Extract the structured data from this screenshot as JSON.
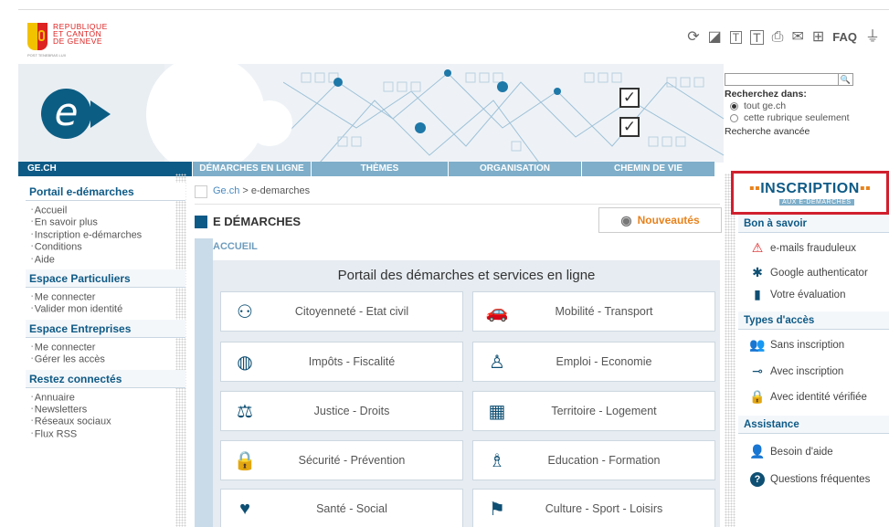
{
  "header": {
    "logo_lines": [
      "REPUBLIQUE",
      "ET CANTON",
      "DE GENEVE"
    ],
    "logo_sub": "POST TENEBRAS LUX",
    "toolbar": [
      {
        "name": "share-icon",
        "glyph": "⟳"
      },
      {
        "name": "edit-icon",
        "glyph": "◪"
      },
      {
        "name": "text-small-icon",
        "glyph": "T"
      },
      {
        "name": "text-large-icon",
        "glyph": "T"
      },
      {
        "name": "print-icon",
        "glyph": "⎙"
      },
      {
        "name": "mail-icon",
        "glyph": "✉"
      },
      {
        "name": "sitemap-icon",
        "glyph": "⊞"
      },
      {
        "name": "faq-link",
        "glyph": "FAQ"
      },
      {
        "name": "accessibility-icon",
        "glyph": "⏚"
      }
    ]
  },
  "banner": {
    "e_letter": "e"
  },
  "search": {
    "button": "🔍",
    "label": "Recherchez dans:",
    "options": [
      "tout ge.ch",
      "cette rubrique seulement"
    ],
    "advanced": "Recherche avancée"
  },
  "nav": {
    "home": "GE.CH",
    "tabs": [
      "DÉMARCHES EN LIGNE",
      "THÈMES",
      "ORGANISATION",
      "CHEMIN DE VIE"
    ]
  },
  "sidebar": {
    "sections": [
      {
        "title": "Portail e-démarches",
        "items": [
          "Accueil",
          "En savoir plus",
          "Inscription e-démarches",
          "Conditions",
          "Aide"
        ]
      },
      {
        "title": "Espace Particuliers",
        "items": [
          "Me connecter",
          "Valider mon identité"
        ]
      },
      {
        "title": "Espace Entreprises",
        "items": [
          "Me connecter",
          "Gérer les accès"
        ]
      },
      {
        "title": "Restez connectés",
        "items": [
          "Annuaire",
          "Newsletters",
          "Réseaux sociaux",
          "Flux RSS"
        ]
      }
    ]
  },
  "main": {
    "breadcrumb_home": "Ge.ch",
    "breadcrumb_sep": " > ",
    "breadcrumb_current": "e-demarches",
    "heading": "E DÉMARCHES",
    "news_button": "Nouveautés",
    "section_label": "ACCUEIL",
    "panel_title": "Portail des démarches et services en ligne",
    "cards": [
      {
        "label": "Citoyenneté - Etat civil",
        "icon": "citizenship-icon",
        "glyph": "⚇"
      },
      {
        "label": "Mobilité - Transport",
        "icon": "car-icon",
        "glyph": "🚗"
      },
      {
        "label": "Impôts - Fiscalité",
        "icon": "coins-icon",
        "glyph": "◍"
      },
      {
        "label": "Emploi - Economie",
        "icon": "worker-icon",
        "glyph": "♙"
      },
      {
        "label": "Justice - Droits",
        "icon": "scales-icon",
        "glyph": "⚖"
      },
      {
        "label": "Territoire - Logement",
        "icon": "building-icon",
        "glyph": "▦"
      },
      {
        "label": "Sécurité - Prévention",
        "icon": "lock-icon",
        "glyph": "🔒"
      },
      {
        "label": "Education - Formation",
        "icon": "teacher-icon",
        "glyph": "♗"
      },
      {
        "label": "Santé - Social",
        "icon": "heart-hands-icon",
        "glyph": "♥"
      },
      {
        "label": "Culture - Sport - Loisirs",
        "icon": "runner-icon",
        "glyph": "⚑"
      }
    ]
  },
  "right": {
    "inscription_main": "INSCRIPTION",
    "inscription_sub": "AUX E-DÉMARCHES",
    "bon_a_savoir": "Bon à savoir",
    "bon_items": [
      {
        "label": "e-mails frauduleux",
        "icon": "warning-icon",
        "glyph": "⚠"
      },
      {
        "label": "Google authenticator",
        "icon": "gear-icon",
        "glyph": "✱"
      },
      {
        "label": "Votre évaluation",
        "icon": "bar-chart-icon",
        "glyph": "▮"
      }
    ],
    "types_acces": "Types d'accès",
    "types_items": [
      {
        "label": "Sans inscription",
        "icon": "users-icon",
        "glyph": "👥"
      },
      {
        "label": "Avec inscription",
        "icon": "key-icon",
        "glyph": "⊸"
      },
      {
        "label": "Avec identité vérifiée",
        "icon": "lock-icon",
        "glyph": "🔒"
      }
    ],
    "assistance": "Assistance",
    "assist_items": [
      {
        "label": "Besoin d'aide",
        "icon": "person-icon",
        "glyph": "👤"
      },
      {
        "label": "Questions fréquentes",
        "icon": "question-icon",
        "glyph": "?"
      }
    ]
  }
}
